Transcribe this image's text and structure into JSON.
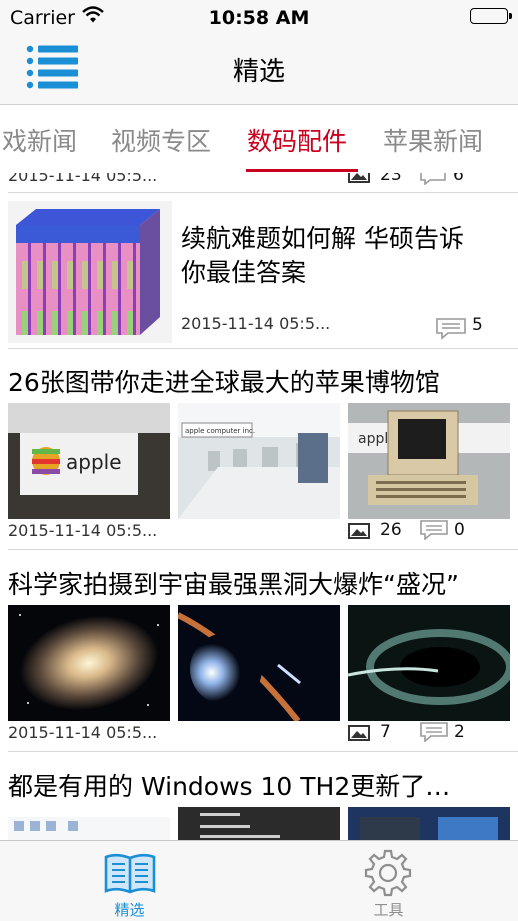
{
  "status_bar": {
    "carrier": "Carrier",
    "time": "10:58 AM"
  },
  "navbar": {
    "title": "精选",
    "menu_icon": "list-menu-icon"
  },
  "tabs": [
    {
      "label": "戏新闻",
      "active": false
    },
    {
      "label": "视频专区",
      "active": false
    },
    {
      "label": "数码配件",
      "active": true
    },
    {
      "label": "苹果新闻",
      "active": false
    }
  ],
  "accent_color": "#c9001f",
  "feed": {
    "partial_top": {
      "date": "2015-11-14 05:5...",
      "images": "23",
      "comments": "6"
    },
    "item1": {
      "title_line1": "续航难题如何解 华硕告诉",
      "title_line2": "你最佳答案",
      "date": "2015-11-14 05:5...",
      "comments": "5"
    },
    "item2": {
      "title": "26张图带你走进全球最大的苹果博物馆",
      "date": "2015-11-14 05:5...",
      "images": "26",
      "comments": "0"
    },
    "item3": {
      "title": "科学家拍摄到宇宙最强黑洞大爆炸“盛况”",
      "date": "2015-11-14 05:5...",
      "images": "7",
      "comments": "2"
    },
    "item4": {
      "title": "都是有用的 Windows 10 TH2更新了…"
    }
  },
  "tabbar": {
    "items": [
      {
        "label": "精选",
        "icon": "book-icon",
        "active": true
      },
      {
        "label": "工具",
        "icon": "gear-icon",
        "active": false
      }
    ]
  }
}
